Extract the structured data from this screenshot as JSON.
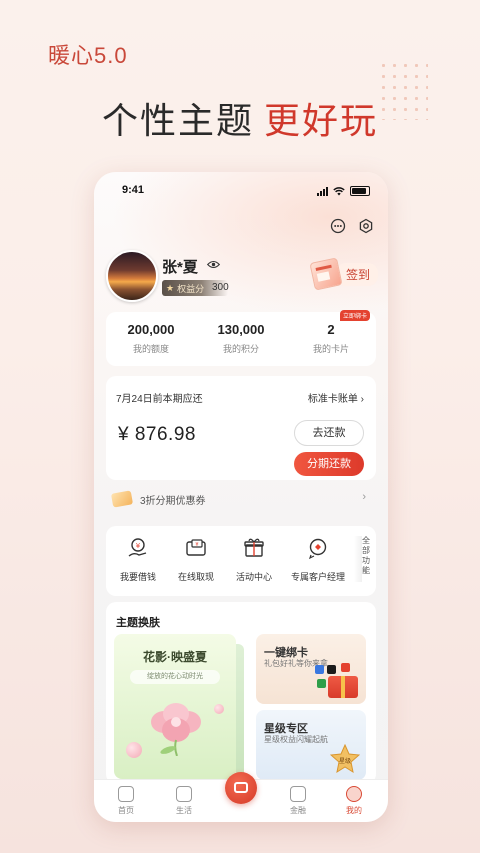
{
  "promo": {
    "tag": "暖心5.0",
    "headline_main": "个性主题",
    "headline_accent": "更好玩"
  },
  "status_bar": {
    "time": "9:41"
  },
  "profile": {
    "name": "张*夏",
    "rights_label": "权益分",
    "rights_value": "300",
    "checkin_label": "签到"
  },
  "stats": [
    {
      "value": "200,000",
      "label": "我的额度"
    },
    {
      "value": "130,000",
      "label": "我的积分"
    },
    {
      "value": "2",
      "label": "我的卡片",
      "tag": "立即绑卡"
    }
  ],
  "bill": {
    "due_text": "7月24日前本期应还",
    "link_label": "标准卡账单",
    "amount": "¥ 876.98",
    "repay_label": "去还款",
    "installment_label": "分期还款"
  },
  "coupon": {
    "text": "3折分期优惠券"
  },
  "services": [
    {
      "label": "我要借钱",
      "icon": "loan-icon"
    },
    {
      "label": "在线取现",
      "icon": "cash-icon"
    },
    {
      "label": "活动中心",
      "icon": "gift-icon"
    },
    {
      "label": "专属客户经理",
      "icon": "manager-icon"
    }
  ],
  "services_more": "全部功能",
  "themes": {
    "title": "主题换肤",
    "main_title": "花影·映盛夏",
    "main_sub": "绽放的花心动时光",
    "bind_title": "一键绑卡",
    "bind_sub": "礼包好礼等你来拿",
    "star_title": "星级专区",
    "star_sub": "星级权益闪耀起航",
    "star_badge": "星级"
  },
  "tabs": [
    {
      "label": "首页",
      "icon": "home-icon"
    },
    {
      "label": "生活",
      "icon": "bag-icon"
    },
    {
      "label": "",
      "icon": "card-center-icon"
    },
    {
      "label": "金融",
      "icon": "wallet-icon"
    },
    {
      "label": "我的",
      "icon": "profile-icon"
    }
  ],
  "colors": {
    "accent": "#d0382b",
    "brand_red": "#e4422f"
  }
}
